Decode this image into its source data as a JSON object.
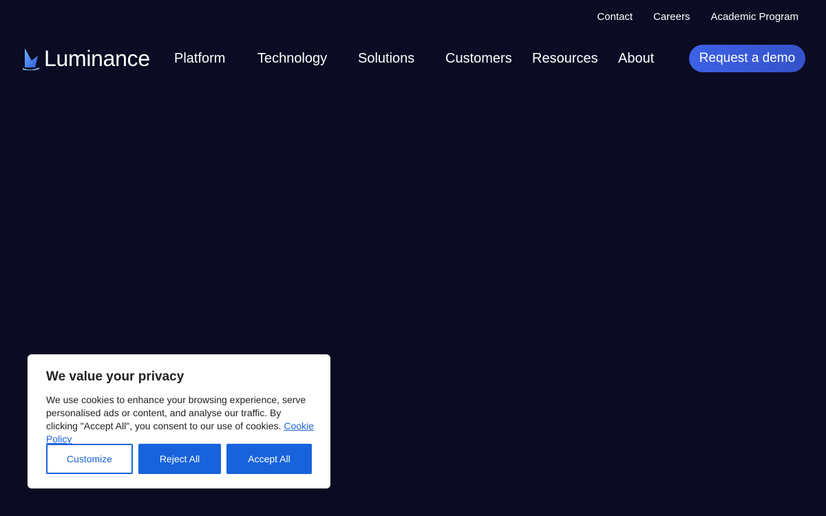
{
  "util_nav": {
    "items": [
      {
        "label": "Contact"
      },
      {
        "label": "Careers"
      },
      {
        "label": "Academic Program"
      }
    ]
  },
  "brand": {
    "name": "Luminance",
    "logo_icon": "luminance-sail-icon",
    "accent": "#3d62e6"
  },
  "main_nav": {
    "items": [
      {
        "label": "Platform"
      },
      {
        "label": "Technology"
      },
      {
        "label": "Solutions"
      },
      {
        "label": "Customers"
      },
      {
        "label": "Resources"
      },
      {
        "label": "About"
      }
    ],
    "cta_label": "Request a demo"
  },
  "cookie_banner": {
    "title": "We value your privacy",
    "body": "We use cookies to enhance your browsing experience, serve personalised ads or content, and analyse our traffic. By clicking \"Accept All\", you consent to our use of cookies.",
    "link_label": "Cookie Policy",
    "buttons": {
      "customize": "Customize",
      "reject": "Reject All",
      "accept": "Accept All"
    },
    "button_color": "#1863dc"
  },
  "colors": {
    "background": "#0b0c23",
    "text": "#ffffff"
  }
}
